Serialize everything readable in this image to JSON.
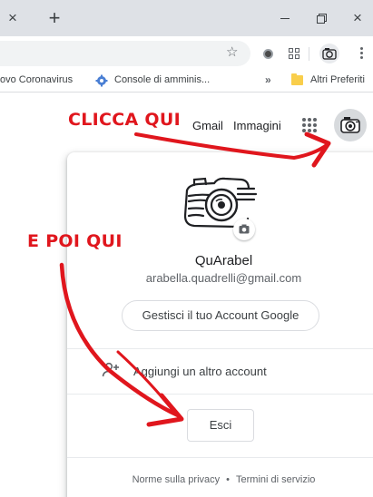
{
  "browser": {
    "tab_close_glyph": "×",
    "new_tab_glyph": "+",
    "window_controls": {
      "minimize": "minimize-icon",
      "maximize": "restore-icon",
      "close_glyph": "×"
    },
    "toolbar": {
      "bookmark_star_glyph": "☆",
      "menu_icon": "more-vert-icon"
    },
    "bookmarks": {
      "item1": "ovo Coronavirus",
      "item2": "Console di amminis...",
      "overflow": "»",
      "item3": "Altri Preferiti"
    }
  },
  "google_header": {
    "gmail": "Gmail",
    "images": "Immagini"
  },
  "account_card": {
    "name": "QuArabel",
    "email": "arabella.quadrelli@gmail.com",
    "manage_button": "Gestisci il tuo Account Google",
    "add_account": "Aggiungi un altro account",
    "sign_out": "Esci",
    "privacy": "Norme sulla privacy",
    "separator": "•",
    "terms": "Termini di servizio"
  },
  "annotations": {
    "click_here": "CLICCA QUI",
    "then_here": "E POI QUI",
    "color": "#e0161d"
  }
}
